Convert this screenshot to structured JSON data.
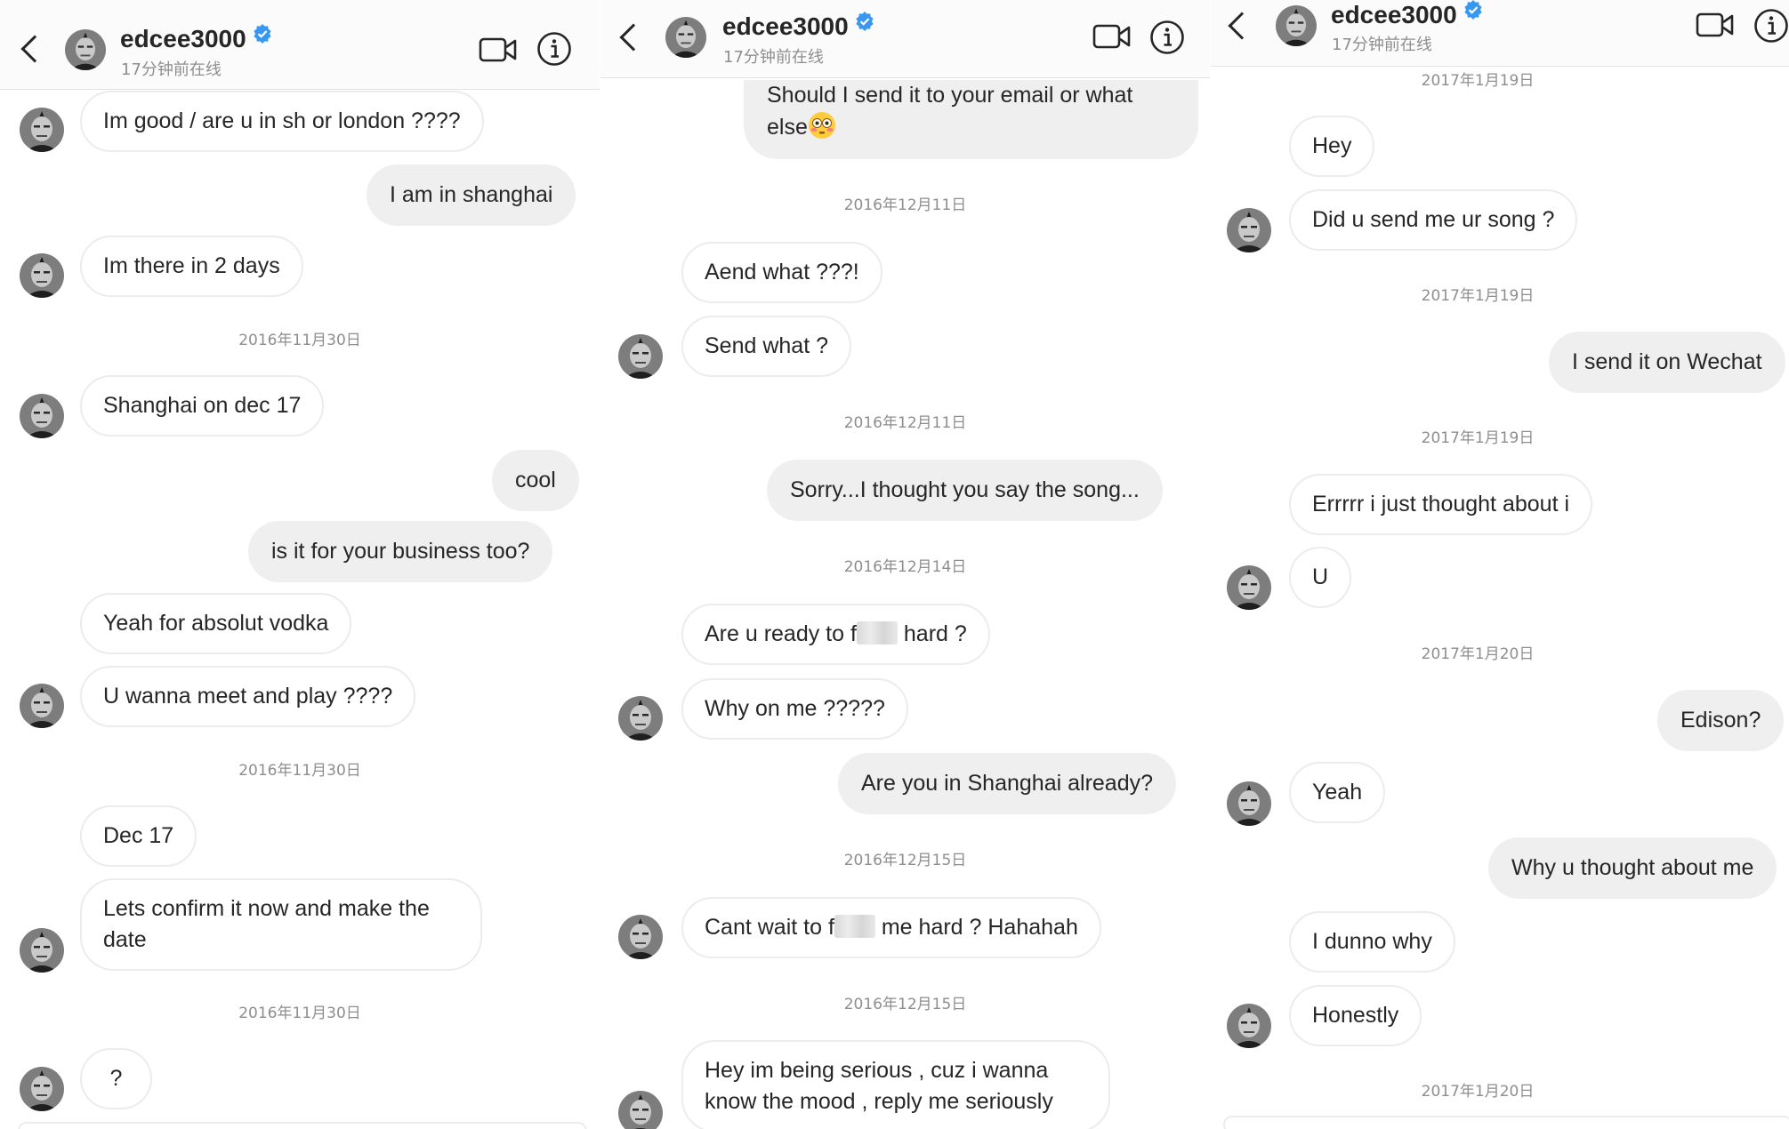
{
  "panels": [
    {
      "header": {
        "username": "edcee3000",
        "status": "17分钟前在线"
      },
      "messages": [
        {
          "text": "Im good / are u in sh or london ????"
        },
        {
          "text": "I am in shanghai"
        },
        {
          "text": "Im there in 2 days"
        },
        {
          "date": "2016年11月30日"
        },
        {
          "text": "Shanghai on dec 17"
        },
        {
          "text": "cool"
        },
        {
          "text": "is it for your business too?"
        },
        {
          "text": "Yeah for absolut vodka"
        },
        {
          "text": "U wanna meet and play ????"
        },
        {
          "date": "2016年11月30日"
        },
        {
          "text": "Dec 17"
        },
        {
          "text": "Lets confirm it now and make the",
          "text2": "date"
        },
        {
          "date": "2016年11月30日"
        },
        {
          "text": "?"
        }
      ]
    },
    {
      "header": {
        "username": "edcee3000",
        "status": "17分钟前在线"
      },
      "messages": [
        {
          "text": "Should I send it to your email or what",
          "text2": "else"
        },
        {
          "date": "2016年12月11日"
        },
        {
          "text": "Aend what ???!"
        },
        {
          "text": "Send what ?"
        },
        {
          "date": "2016年12月11日"
        },
        {
          "text": "Sorry...I thought you say the song..."
        },
        {
          "date": "2016年12月14日"
        },
        {
          "text": "Are u ready to f",
          "text2": "hard ?"
        },
        {
          "text": "Why on me ?????"
        },
        {
          "text": "Are you in Shanghai already?"
        },
        {
          "date": "2016年12月15日"
        },
        {
          "text": "Cant wait to f",
          "text2": "me hard ? Hahahah"
        },
        {
          "date": "2016年12月15日"
        },
        {
          "text": "Hey im being serious , cuz i wanna",
          "text2": "know the mood , reply me seriously"
        }
      ]
    },
    {
      "header": {
        "username": "edcee3000",
        "status": "17分钟前在线"
      },
      "messages": [
        {
          "date": "2017年1月19日"
        },
        {
          "text": "Hey"
        },
        {
          "text": "Did u send me ur song ?"
        },
        {
          "date": "2017年1月19日"
        },
        {
          "text": "I send it on Wechat"
        },
        {
          "date": "2017年1月19日"
        },
        {
          "text": "Errrrr i just thought about i"
        },
        {
          "text": "U"
        },
        {
          "date": "2017年1月20日"
        },
        {
          "text": "Edison?"
        },
        {
          "text": "Yeah"
        },
        {
          "text": "Why u thought about me"
        },
        {
          "text": "I dunno why"
        },
        {
          "text": "Honestly"
        },
        {
          "date": "2017年1月20日"
        }
      ]
    }
  ]
}
